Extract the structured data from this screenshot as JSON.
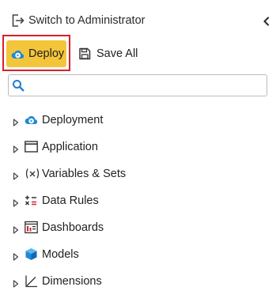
{
  "topbar": {
    "switch_label": "Switch to Administrator",
    "switch_icon": "switch-user-icon",
    "collapse_icon": "chevron-left-icon"
  },
  "toolbar": {
    "deploy_label": "Deploy",
    "deploy_icon": "cloud-play-icon",
    "save_all_label": "Save All",
    "save_all_icon": "save-icon",
    "deploy_color": "#f3c53a",
    "highlight_color": "#d8202a"
  },
  "search": {
    "placeholder": "",
    "value": "",
    "icon": "search-icon"
  },
  "tree": {
    "items": [
      {
        "label": "Deployment",
        "icon": "cloud-deploy-icon"
      },
      {
        "label": "Application",
        "icon": "window-icon"
      },
      {
        "label": "Variables & Sets",
        "icon": "variable-icon"
      },
      {
        "label": "Data Rules",
        "icon": "rules-icon"
      },
      {
        "label": "Dashboards",
        "icon": "dashboard-icon"
      },
      {
        "label": "Models",
        "icon": "cube-icon"
      },
      {
        "label": "Dimensions",
        "icon": "axis-icon"
      }
    ]
  }
}
